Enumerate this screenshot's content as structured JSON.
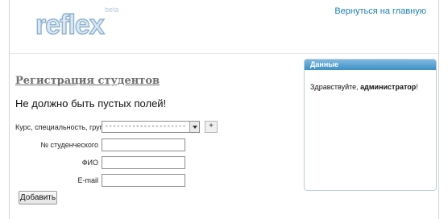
{
  "header": {
    "logo_text": "reflex",
    "logo_badge": "beta",
    "home_link": "Вернуться на главную"
  },
  "main": {
    "title": "Регистрация студентов",
    "error": "Не должно быть пустых полей!",
    "form": {
      "course_label": "Курс, специальность, группа",
      "course_value": "--------------------------------------------",
      "add_button": "+",
      "student_id_label": "№ студенческого",
      "student_id_value": "",
      "name_label": "ФИО",
      "name_value": "",
      "email_label": "E-mail",
      "email_value": "",
      "submit_label": "Добавить"
    }
  },
  "panel": {
    "title": "Данные",
    "greeting": "Здравствуйте,",
    "user": "администратор",
    "suffix": "!"
  },
  "colors": {
    "link": "#1a7fb5",
    "panel_header": "#3d8fc6",
    "title": "#6e6e6e"
  }
}
